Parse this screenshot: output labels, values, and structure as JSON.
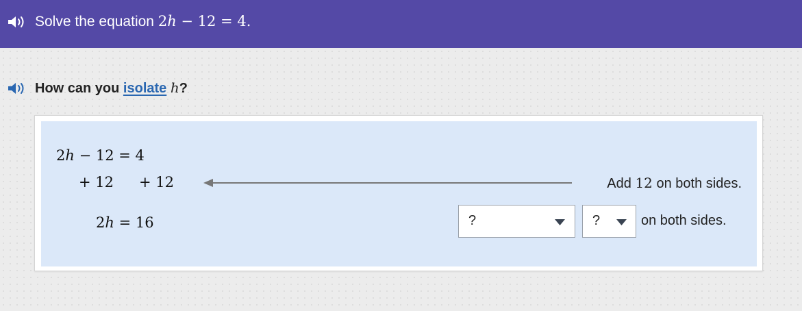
{
  "header": {
    "speaker_icon": "speaker-icon",
    "prompt_text": "Solve the equation",
    "equation_lhs_coef": "2",
    "equation_lhs_var": "h",
    "equation_rest": " − 12 = 4.",
    "background_color": "#5449a6"
  },
  "question": {
    "speaker_icon": "speaker-icon",
    "prefix": "How can you",
    "link_text": "isolate",
    "variable": "h",
    "suffix": "?"
  },
  "work": {
    "line1_coef": "2",
    "line1_var": "h",
    "line1_rest": " − 12 = 4",
    "line2_left": "+ 12",
    "line2_right": "+ 12",
    "line3_coef": "2",
    "line3_var": "h",
    "line3_rest": " = 16",
    "step1_prefix": "Add",
    "step1_number": "12",
    "step1_suffix": "on both sides.",
    "step2_suffix": "on both sides."
  },
  "dropdowns": {
    "operation_value": "?",
    "number_value": "?"
  },
  "colors": {
    "panel": "#dbe8f9",
    "link": "#2a67b1",
    "speaker_icon_question": "#2a67b1"
  }
}
